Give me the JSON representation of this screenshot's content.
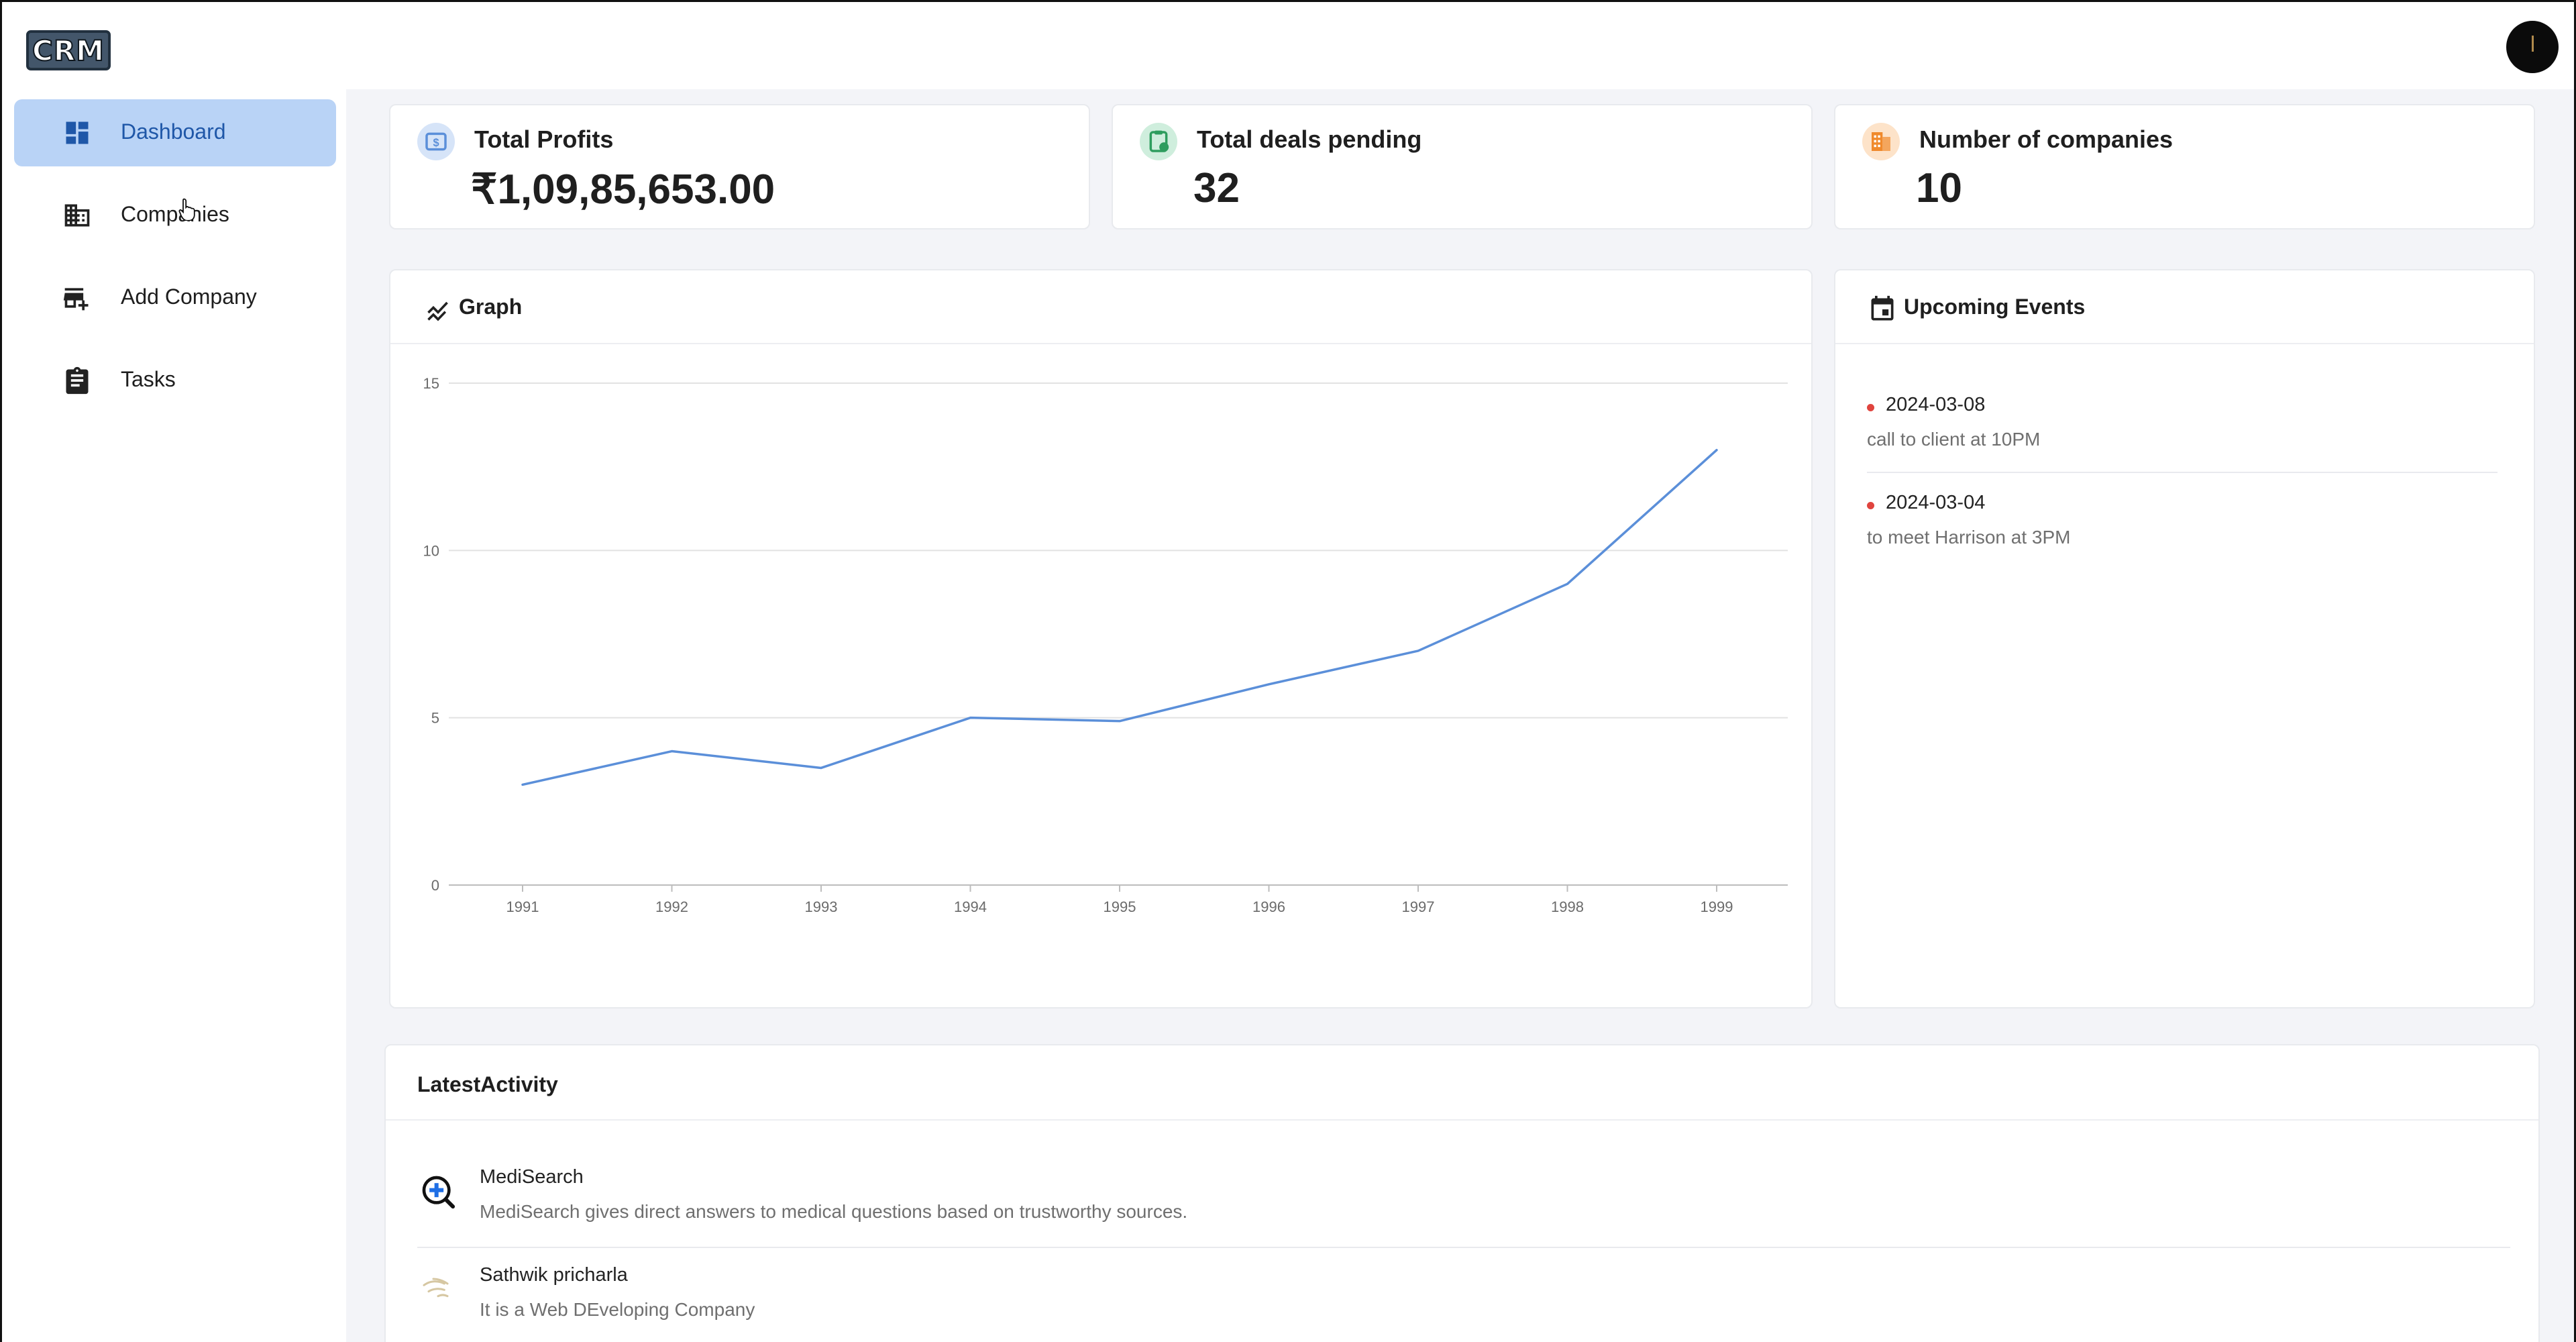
{
  "app": {
    "logo_text": "CRM"
  },
  "sidebar": {
    "items": [
      {
        "label": "Dashboard",
        "icon": "dashboard-icon",
        "active": true
      },
      {
        "label": "Companies",
        "icon": "building-icon",
        "active": false
      },
      {
        "label": "Add Company",
        "icon": "add-store-icon",
        "active": false
      },
      {
        "label": "Tasks",
        "icon": "clipboard-icon",
        "active": false
      }
    ]
  },
  "stats": [
    {
      "title": "Total Profits",
      "value": "₹1,09,85,653.00",
      "icon": "money-icon",
      "color": "#6a9be0"
    },
    {
      "title": "Total deals pending",
      "value": "32",
      "icon": "clipboard-clock-icon",
      "color": "#3cb371"
    },
    {
      "title": "Number of companies",
      "value": "10",
      "icon": "building-icon",
      "color": "#f39a4c"
    }
  ],
  "graph": {
    "title": "Graph",
    "icon": "line-chart-icon"
  },
  "chart_data": {
    "type": "line",
    "x": [
      1991,
      1992,
      1993,
      1994,
      1995,
      1996,
      1997,
      1998,
      1999
    ],
    "series": [
      {
        "values": [
          3,
          4,
          3.5,
          5,
          4.9,
          6,
          7,
          9,
          13
        ]
      }
    ],
    "ylim": [
      0,
      15
    ],
    "yticks": [
      0,
      5,
      10,
      15
    ],
    "grid": true,
    "line_color": "#5b8fd9"
  },
  "events": {
    "title": "Upcoming Events",
    "icon": "calendar-icon",
    "items": [
      {
        "date": "2024-03-08",
        "description": "call to client at 10PM"
      },
      {
        "date": "2024-03-04",
        "description": "to meet Harrison at 3PM"
      }
    ]
  },
  "activity": {
    "title": "LatestActivity",
    "items": [
      {
        "name": "MediSearch",
        "description": "MediSearch gives direct answers to medical questions based on trustworthy sources.",
        "icon": "medisearch-logo-icon"
      },
      {
        "name": "Sathwik pricharla",
        "description": "It is a Web DEveloping Company",
        "icon": "company-logo-icon"
      }
    ]
  },
  "colors": {
    "accent": "#b9d3f6",
    "accent_text": "#1f57a8",
    "event_dot": "#e0443e"
  }
}
